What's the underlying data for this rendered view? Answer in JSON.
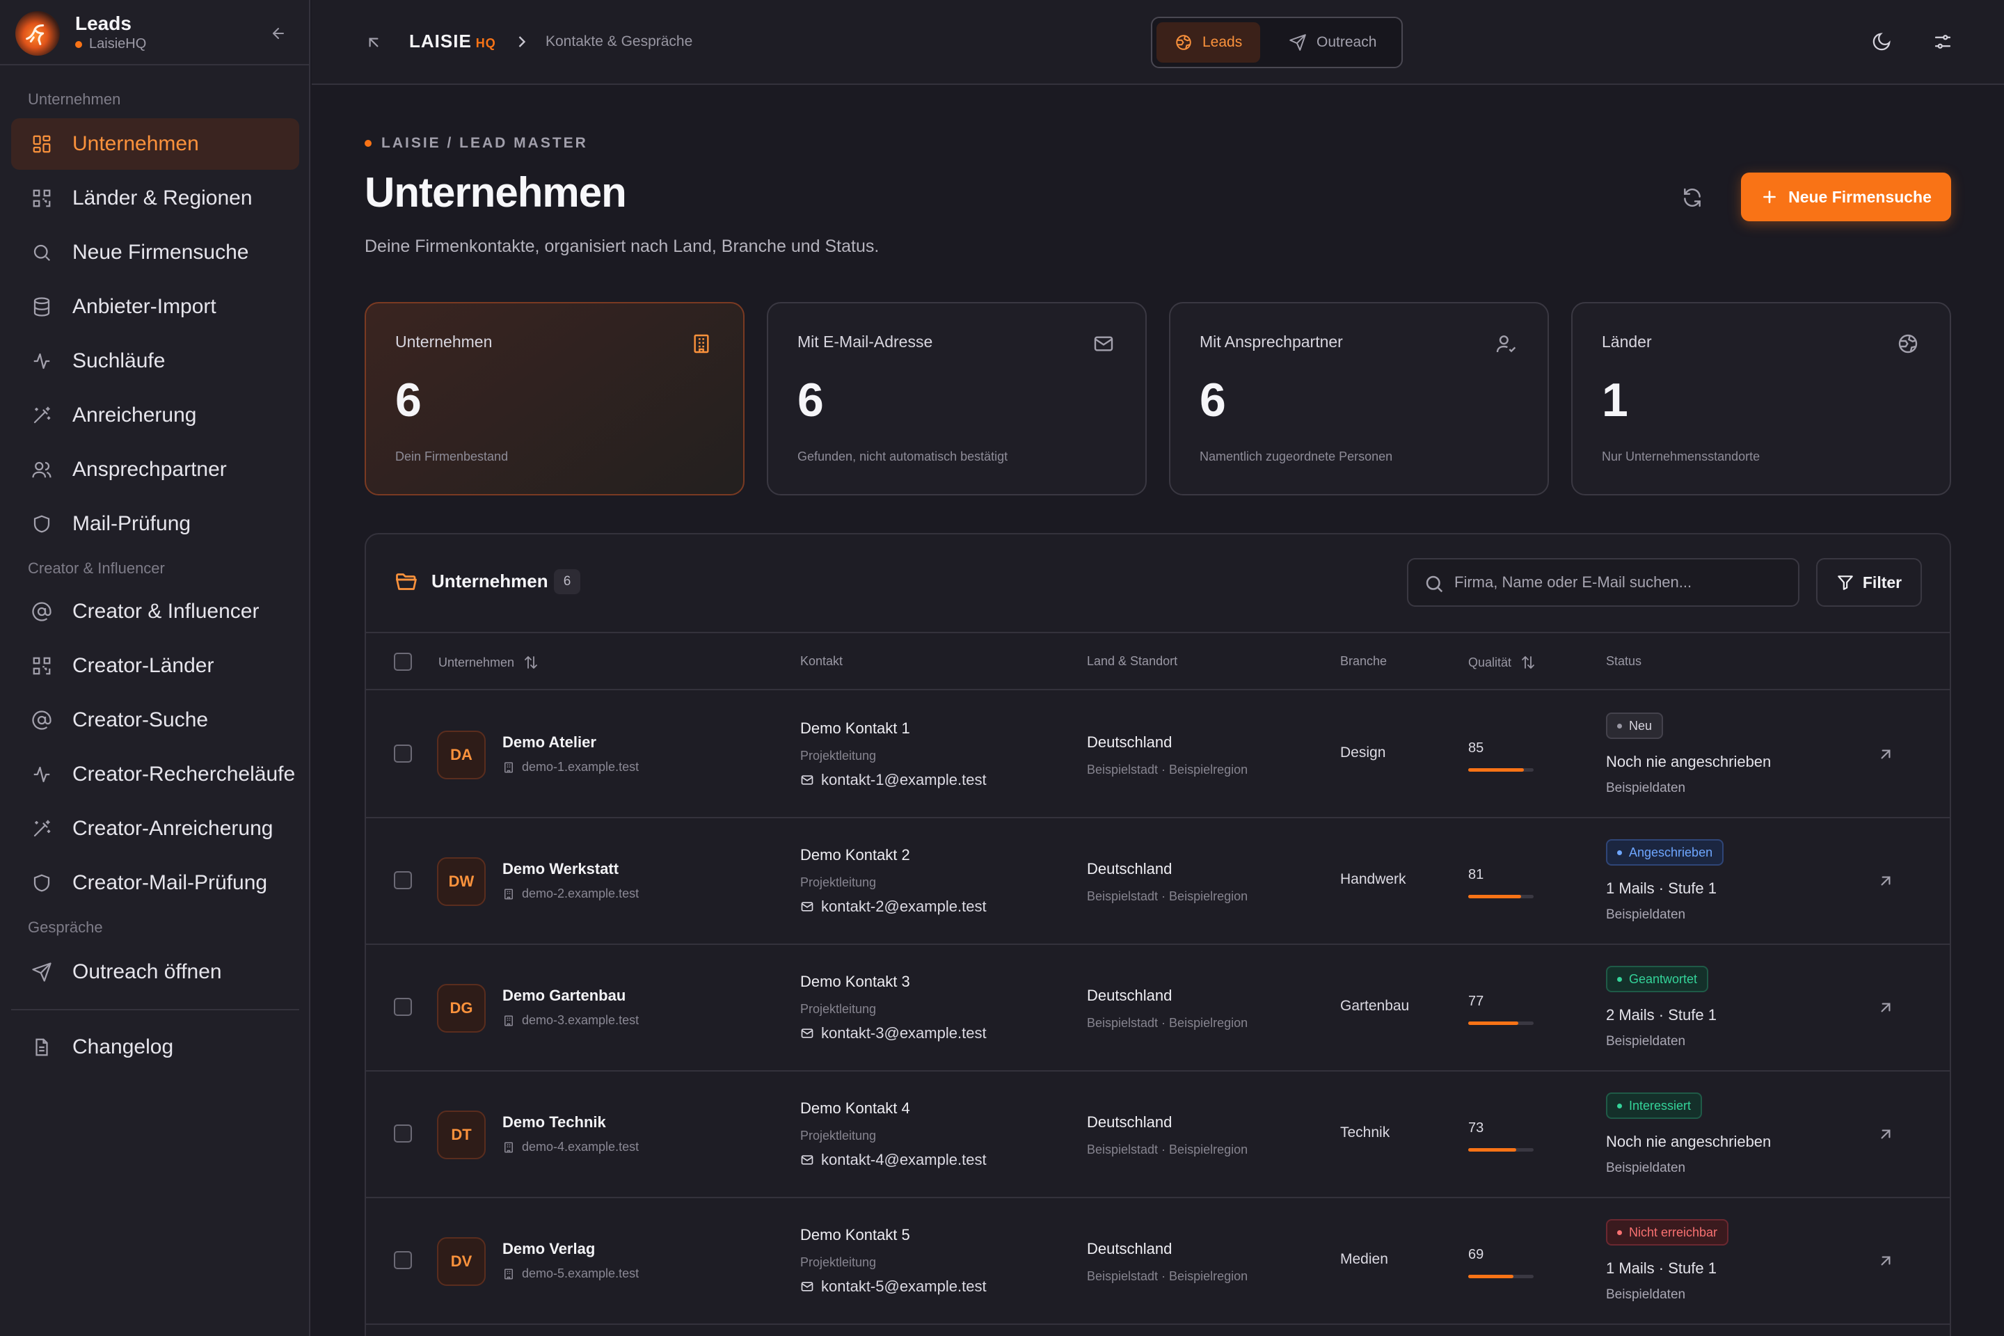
{
  "sidebar": {
    "app_title": "Leads",
    "workspace": "LaisieHQ",
    "sections": {
      "unternehmen": "Unternehmen",
      "creator": "Creator & Influencer",
      "gespraeche": "Gespräche"
    },
    "items": [
      {
        "label": "Unternehmen",
        "icon": "grid-icon"
      },
      {
        "label": "Länder & Regionen",
        "icon": "qr-grid-icon"
      },
      {
        "label": "Neue Firmensuche",
        "icon": "search-icon"
      },
      {
        "label": "Anbieter-Import",
        "icon": "database-icon"
      },
      {
        "label": "Suchläufe",
        "icon": "activity-icon"
      },
      {
        "label": "Anreicherung",
        "icon": "magic-wand-icon"
      },
      {
        "label": "Ansprechpartner",
        "icon": "users-icon"
      },
      {
        "label": "Mail-Prüfung",
        "icon": "shield-icon"
      },
      {
        "label": "Creator & Influencer",
        "icon": "at-icon"
      },
      {
        "label": "Creator-Länder",
        "icon": "qr-grid-icon"
      },
      {
        "label": "Creator-Suche",
        "icon": "at-icon"
      },
      {
        "label": "Creator-Rechercheläufe",
        "icon": "activity-icon"
      },
      {
        "label": "Creator-Anreicherung",
        "icon": "magic-wand-icon"
      },
      {
        "label": "Creator-Mail-Prüfung",
        "icon": "shield-icon"
      },
      {
        "label": "Outreach öffnen",
        "icon": "send-icon"
      },
      {
        "label": "Changelog",
        "icon": "document-icon"
      }
    ]
  },
  "topbar": {
    "brand": "LAISIE",
    "brand_suffix": "HQ",
    "breadcrumb": "Kontakte & Gespräche",
    "tabs": [
      {
        "label": "Leads",
        "active": true
      },
      {
        "label": "Outreach",
        "active": false
      }
    ]
  },
  "header": {
    "eyebrow": "LAISIE / LEAD MASTER",
    "title": "Unternehmen",
    "description": "Deine Firmenkontakte, organisiert nach Land, Branche und Status.",
    "primary_button": "Neue Firmensuche"
  },
  "stats": [
    {
      "title": "Unternehmen",
      "value": "6",
      "sub": "Dein Firmenbestand",
      "icon": "building-icon"
    },
    {
      "title": "Mit E-Mail-Adresse",
      "value": "6",
      "sub": "Gefunden, nicht automatisch bestätigt",
      "icon": "mail-icon"
    },
    {
      "title": "Mit Ansprechpartner",
      "value": "6",
      "sub": "Namentlich zugeordnete Personen",
      "icon": "user-check-icon"
    },
    {
      "title": "Länder",
      "value": "1",
      "sub": "Nur Unternehmensstandorte",
      "icon": "globe-icon"
    }
  ],
  "table": {
    "title": "Unternehmen",
    "count": "6",
    "search_placeholder": "Firma, Name oder E-Mail suchen...",
    "filter_label": "Filter",
    "columns": [
      "Unternehmen",
      "Kontakt",
      "Land & Standort",
      "Branche",
      "Qualität",
      "Status"
    ],
    "rows": [
      {
        "initials": "DA",
        "name": "Demo Atelier",
        "domain": "demo-1.example.test",
        "contact": "Demo Kontakt 1",
        "role": "Projektleitung",
        "email": "kontakt-1@example.test",
        "country": "Deutschland",
        "location": "Beispielstadt · Beispielregion",
        "branche": "Design",
        "quality": 85,
        "badge": "Neu",
        "badge_type": "neu",
        "status": "Noch nie angeschrieben",
        "note": "Beispieldaten"
      },
      {
        "initials": "DW",
        "name": "Demo Werkstatt",
        "domain": "demo-2.example.test",
        "contact": "Demo Kontakt 2",
        "role": "Projektleitung",
        "email": "kontakt-2@example.test",
        "country": "Deutschland",
        "location": "Beispielstadt · Beispielregion",
        "branche": "Handwerk",
        "quality": 81,
        "badge": "Angeschrieben",
        "badge_type": "ang",
        "status": "1 Mails · Stufe 1",
        "note": "Beispieldaten"
      },
      {
        "initials": "DG",
        "name": "Demo Gartenbau",
        "domain": "demo-3.example.test",
        "contact": "Demo Kontakt 3",
        "role": "Projektleitung",
        "email": "kontakt-3@example.test",
        "country": "Deutschland",
        "location": "Beispielstadt · Beispielregion",
        "branche": "Gartenbau",
        "quality": 77,
        "badge": "Geantwortet",
        "badge_type": "gea",
        "status": "2 Mails · Stufe 1",
        "note": "Beispieldaten"
      },
      {
        "initials": "DT",
        "name": "Demo Technik",
        "domain": "demo-4.example.test",
        "contact": "Demo Kontakt 4",
        "role": "Projektleitung",
        "email": "kontakt-4@example.test",
        "country": "Deutschland",
        "location": "Beispielstadt · Beispielregion",
        "branche": "Technik",
        "quality": 73,
        "badge": "Interessiert",
        "badge_type": "int",
        "status": "Noch nie angeschrieben",
        "note": "Beispieldaten"
      },
      {
        "initials": "DV",
        "name": "Demo Verlag",
        "domain": "demo-5.example.test",
        "contact": "Demo Kontakt 5",
        "role": "Projektleitung",
        "email": "kontakt-5@example.test",
        "country": "Deutschland",
        "location": "Beispielstadt · Beispielregion",
        "branche": "Medien",
        "quality": 69,
        "badge": "Nicht erreichbar",
        "badge_type": "nic",
        "status": "1 Mails · Stufe 1",
        "note": "Beispieldaten"
      }
    ]
  },
  "colors": {
    "accent": "#f97316",
    "background": "#1b1a22",
    "sidebar": "#201f27"
  }
}
